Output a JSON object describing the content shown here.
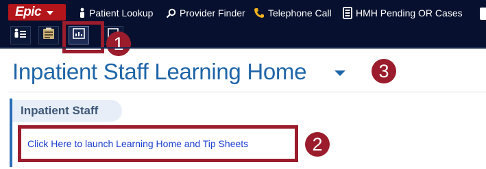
{
  "toolbar": {
    "brand": "Epic",
    "items": [
      {
        "label": "Patient Lookup",
        "icon": "person-icon"
      },
      {
        "label": "Provider Finder",
        "icon": "search-icon"
      },
      {
        "label": "Telephone Call",
        "icon": "phone-icon"
      },
      {
        "label": "HMH Pending OR Cases",
        "icon": "document-icon"
      }
    ]
  },
  "toolrow": {
    "buttons": [
      {
        "icon": "person-list-icon"
      },
      {
        "icon": "clipboard-icon"
      },
      {
        "icon": "dashboard-icon",
        "selected": true
      },
      {
        "icon": "window-icon"
      }
    ]
  },
  "page": {
    "title": "Inpatient Staff Learning Home"
  },
  "section": {
    "title": "Inpatient Staff",
    "link": "Click Here to launch Learning Home and Tip Sheets"
  },
  "callouts": {
    "one": "1",
    "two": "2",
    "three": "3"
  },
  "colors": {
    "toolbar_bg": "#07102e",
    "epic_red": "#b3151a",
    "callout": "#9b1c2c",
    "title_blue": "#1f65a8",
    "link_blue": "#1a3fd0"
  }
}
